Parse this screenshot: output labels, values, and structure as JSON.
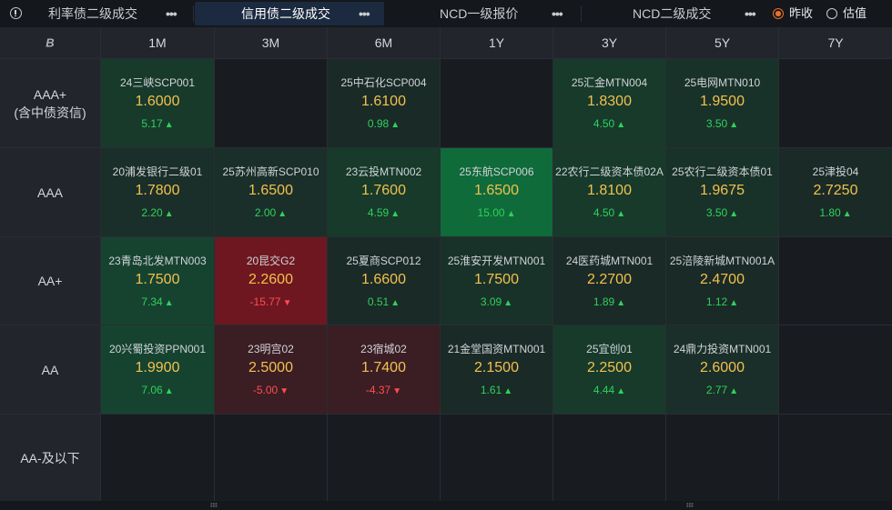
{
  "tabs": [
    {
      "label": "利率债二级成交",
      "active": false
    },
    {
      "label": "信用债二级成交",
      "active": true
    },
    {
      "label": "NCD一级报价",
      "active": false
    },
    {
      "label": "NCD二级成交",
      "active": false
    }
  ],
  "more_glyph": "•••",
  "radios": [
    {
      "label": "昨收",
      "checked": true
    },
    {
      "label": "估值",
      "checked": false
    }
  ],
  "corner_icon": "B",
  "columns": [
    "1M",
    "3M",
    "6M",
    "1Y",
    "3Y",
    "5Y",
    "7Y"
  ],
  "rows": [
    {
      "label": "AAA+",
      "sublabel": "(含中债资信)"
    },
    {
      "label": "AAA",
      "sublabel": ""
    },
    {
      "label": "AA+",
      "sublabel": ""
    },
    {
      "label": "AA",
      "sublabel": ""
    },
    {
      "label": "AA-及以下",
      "sublabel": ""
    }
  ],
  "colors": {
    "up": "#2fd15c",
    "down": "#ff4d4f",
    "yield": "#f2c14e",
    "accent": "#e8702a"
  },
  "cells": [
    [
      {
        "name": "24三峡SCP001",
        "yield": "1.6000",
        "change": "5.17",
        "dir": "up",
        "bg": "#173a2b"
      },
      null,
      {
        "name": "25中石化SCP004",
        "yield": "1.6100",
        "change": "0.98",
        "dir": "up",
        "bg": "#1a2a27"
      },
      null,
      {
        "name": "25汇金MTN004",
        "yield": "1.8300",
        "change": "4.50",
        "dir": "up",
        "bg": "#173a2b"
      },
      {
        "name": "25电网MTN010",
        "yield": "1.9500",
        "change": "3.50",
        "dir": "up",
        "bg": "#193229"
      },
      null
    ],
    [
      {
        "name": "20浦发银行二级01",
        "yield": "1.7800",
        "change": "2.20",
        "dir": "up",
        "bg": "#1a2f29"
      },
      {
        "name": "25苏州高新SCP010",
        "yield": "1.6500",
        "change": "2.00",
        "dir": "up",
        "bg": "#1a2f29"
      },
      {
        "name": "23云投MTN002",
        "yield": "1.7600",
        "change": "4.59",
        "dir": "up",
        "bg": "#173a2b"
      },
      {
        "name": "25东航SCP006",
        "yield": "1.6500",
        "change": "15.00",
        "dir": "up",
        "bg": "#0f6b3a"
      },
      {
        "name": "22农行二级资本债02A",
        "yield": "1.8100",
        "change": "4.50",
        "dir": "up",
        "bg": "#173a2b"
      },
      {
        "name": "25农行二级资本债01",
        "yield": "1.9675",
        "change": "3.50",
        "dir": "up",
        "bg": "#193229"
      },
      {
        "name": "25津投04",
        "yield": "2.7250",
        "change": "1.80",
        "dir": "up",
        "bg": "#1a2a27"
      }
    ],
    [
      {
        "name": "23青岛北发MTN003",
        "yield": "1.7500",
        "change": "7.34",
        "dir": "up",
        "bg": "#164330"
      },
      {
        "name": "20昆交G2",
        "yield": "2.2600",
        "change": "-15.77",
        "dir": "down",
        "bg": "#6e1720"
      },
      {
        "name": "25夏商SCP012",
        "yield": "1.6600",
        "change": "0.51",
        "dir": "up",
        "bg": "#1a2a27"
      },
      {
        "name": "25淮安开发MTN001",
        "yield": "1.7500",
        "change": "3.09",
        "dir": "up",
        "bg": "#193229"
      },
      {
        "name": "24医药城MTN001",
        "yield": "2.2700",
        "change": "1.89",
        "dir": "up",
        "bg": "#1a2a27"
      },
      {
        "name": "25涪陵新城MTN001A",
        "yield": "2.4700",
        "change": "1.12",
        "dir": "up",
        "bg": "#1a2a27"
      },
      null
    ],
    [
      {
        "name": "20兴蜀投资PPN001",
        "yield": "1.9900",
        "change": "7.06",
        "dir": "up",
        "bg": "#164330"
      },
      {
        "name": "23明宫02",
        "yield": "2.5000",
        "change": "-5.00",
        "dir": "down",
        "bg": "#3b1d24"
      },
      {
        "name": "23宿城02",
        "yield": "1.7400",
        "change": "-4.37",
        "dir": "down",
        "bg": "#3b1d24"
      },
      {
        "name": "21金堂国资MTN001",
        "yield": "2.1500",
        "change": "1.61",
        "dir": "up",
        "bg": "#1a2a27"
      },
      {
        "name": "25宜创01",
        "yield": "2.2500",
        "change": "4.44",
        "dir": "up",
        "bg": "#173a2b"
      },
      {
        "name": "24鼎力投资MTN001",
        "yield": "2.6000",
        "change": "2.77",
        "dir": "up",
        "bg": "#1a2f29"
      },
      null
    ],
    [
      null,
      null,
      null,
      null,
      null,
      null,
      null
    ]
  ]
}
